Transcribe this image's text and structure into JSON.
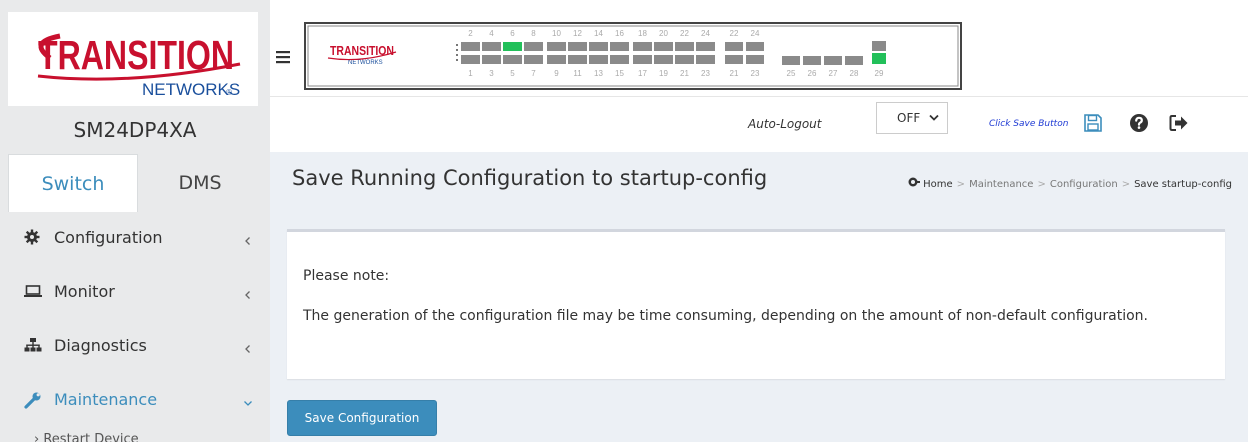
{
  "brand": {
    "logo_line1": "TRANSITION",
    "logo_line2": "NETWORKS",
    "logo_color": "#c8102e",
    "logo_sub_color": "#1a4f9c"
  },
  "device_name": "SM24DP4XA",
  "tabs": [
    {
      "label": "Switch",
      "active": true
    },
    {
      "label": "DMS",
      "active": false
    }
  ],
  "menu": [
    {
      "label": "Configuration",
      "icon": "gear-icon",
      "expanded": false
    },
    {
      "label": "Monitor",
      "icon": "laptop-icon",
      "expanded": false
    },
    {
      "label": "Diagnostics",
      "icon": "sitemap-icon",
      "expanded": false
    },
    {
      "label": "Maintenance",
      "icon": "wrench-icon",
      "expanded": true
    }
  ],
  "submenu_partial": "Restart Device",
  "switch_panel": {
    "logo_text": "TRANSITION",
    "logo_sub": "NETWORKS",
    "top_labels": [
      "2",
      "4",
      "6",
      "8",
      "10",
      "12",
      "14",
      "16",
      "18",
      "20",
      "22",
      "24",
      "22",
      "24"
    ],
    "bottom_labels": [
      "1",
      "3",
      "5",
      "7",
      "9",
      "11",
      "13",
      "15",
      "17",
      "19",
      "21",
      "23",
      "21",
      "23",
      "25",
      "26",
      "27",
      "28",
      "29"
    ],
    "active_port": "6",
    "active_color": "#22c05a"
  },
  "toolbar": {
    "auto_logout_label": "Auto-Logout",
    "auto_logout_value": "OFF",
    "save_hint": "Click Save Button",
    "save_icon": "floppy-disk-icon",
    "help_icon": "question-circle-icon",
    "logout_icon": "sign-out-icon"
  },
  "page": {
    "title": "Save Running Configuration to startup-config",
    "breadcrumb": [
      "Home",
      "Maintenance",
      "Configuration",
      "Save startup-config"
    ]
  },
  "note": {
    "title": "Please note:",
    "text": "The generation of the configuration file may be time consuming, depending on the amount of non-default configuration."
  },
  "save_button_label": "Save Configuration",
  "colors": {
    "accent": "#3c8dbc",
    "sidebar_bg": "#e9eaeb",
    "content_bg": "#ecf0f5"
  }
}
